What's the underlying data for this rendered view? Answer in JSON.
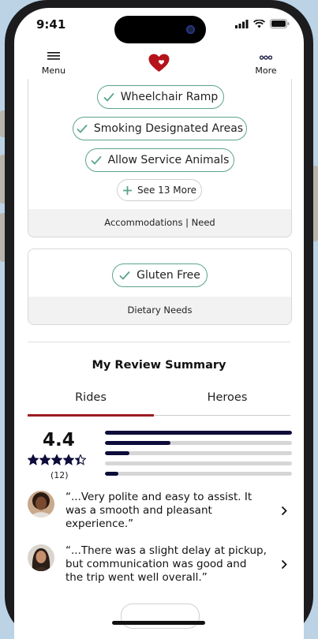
{
  "status_bar": {
    "time": "9:41"
  },
  "header": {
    "menu_label": "Menu",
    "more_label": "More",
    "brand_color": "#b5121b"
  },
  "accommodations": {
    "chips": [
      "Wheelchair Ramp",
      "Smoking Designated Areas",
      "Allow Service Animals"
    ],
    "see_more_label": "See 13 More",
    "footer_label": "Accommodations | Need"
  },
  "dietary": {
    "chips": [
      "Gluten Free"
    ],
    "footer_label": "Dietary Needs"
  },
  "review_summary": {
    "title": "My Review Summary",
    "tabs": [
      {
        "label": "Rides",
        "active": true
      },
      {
        "label": "Heroes",
        "active": false
      }
    ],
    "rating": "4.4",
    "rating_value": 4.4,
    "review_count": "(12)",
    "distribution": [
      1.0,
      0.35,
      0.13,
      0.0,
      0.07
    ],
    "reviews": [
      {
        "text": "“...Very polite and easy to assist. It was a smooth and pleasant experience.”",
        "avatar": "avatar-woman-curly-hair"
      },
      {
        "text": "“...There was a slight delay at pickup, but communication was good and the trip went well overall.”",
        "avatar": "avatar-woman-long-hair"
      }
    ]
  },
  "colors": {
    "accent_green": "#5aa58a",
    "tab_active": "#9b1c22",
    "bar_fill": "#0d0c3a",
    "star": "#0d0c3a"
  }
}
